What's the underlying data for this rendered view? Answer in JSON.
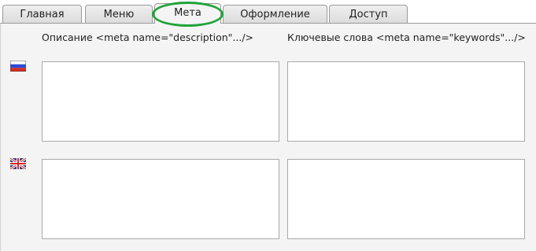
{
  "tabs": [
    {
      "label": "Главная",
      "active": false
    },
    {
      "label": "Меню",
      "active": false
    },
    {
      "label": "Мета",
      "active": true
    },
    {
      "label": "Оформление",
      "active": false
    },
    {
      "label": "Доступ",
      "active": false
    }
  ],
  "colors": {
    "highlight": "#21a33a",
    "panel": "#f4f4f4",
    "tab_border": "#9a9a9a"
  },
  "columns": {
    "description_label": "Описание <meta name=\"description\".../>",
    "keywords_label": "Ключевые слова <meta name=\"keywords\".../>"
  },
  "languages": [
    {
      "flag": "russia-flag-icon",
      "description_value": "",
      "keywords_value": ""
    },
    {
      "flag": "uk-flag-icon",
      "description_value": "",
      "keywords_value": ""
    }
  ]
}
